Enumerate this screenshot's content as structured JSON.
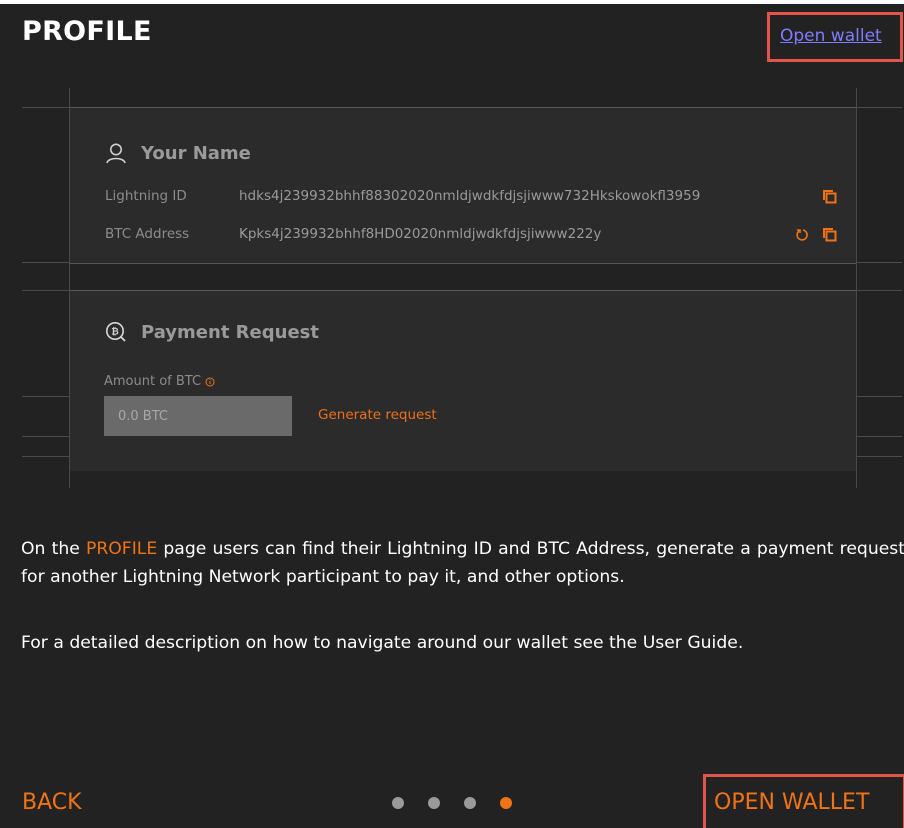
{
  "header": {
    "title": "PROFILE",
    "open_wallet_link": "Open wallet"
  },
  "identity": {
    "name": "Your Name",
    "lightning_id_label": "Lightning ID",
    "lightning_id_value": "hdks4j239932bhhf88302020nmldjwdkfdjsjiwww732Hkskowokfl3959",
    "btc_address_label": "BTC Address",
    "btc_address_value": "Kpks4j239932bhhf8HD02020nmldjwdkfdjsjiwww222y"
  },
  "payment_request": {
    "title": "Payment Request",
    "amount_label": "Amount of BTC",
    "amount_placeholder": "0.0 BTC",
    "generate_link": "Generate request"
  },
  "description": {
    "prefix": "On the ",
    "highlight": "PROFILE",
    "rest": " page users can find their Lightning ID and BTC Address, generate a payment request for another Lightning Network participant to pay it, and other options.",
    "guide_prefix": "For a detailed description on how to navigate around our wallet see the ",
    "guide_link": "User Guide."
  },
  "footer": {
    "back_label": "BACK",
    "open_wallet_label": "OPEN WALLET",
    "pagination": {
      "total": 4,
      "active": 4
    }
  },
  "colors": {
    "background": "#222222",
    "accent": "#f07316",
    "link": "#7f7cff",
    "highlight_box": "#e2554b"
  }
}
